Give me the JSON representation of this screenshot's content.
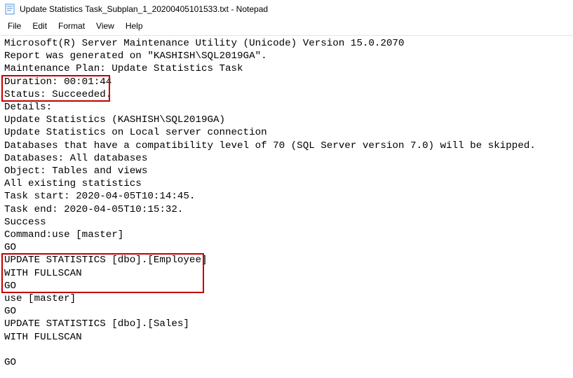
{
  "window": {
    "title": "Update Statistics Task_Subplan_1_20200405101533.txt - Notepad"
  },
  "menu": {
    "file": "File",
    "edit": "Edit",
    "format": "Format",
    "view": "View",
    "help": "Help"
  },
  "content": {
    "lines": [
      "Microsoft(R) Server Maintenance Utility (Unicode) Version 15.0.2070",
      "Report was generated on \"KASHISH\\SQL2019GA\".",
      "Maintenance Plan: Update Statistics Task",
      "Duration: 00:01:44",
      "Status: Succeeded.",
      "Details:",
      "Update Statistics (KASHISH\\SQL2019GA)",
      "Update Statistics on Local server connection",
      "Databases that have a compatibility level of 70 (SQL Server version 7.0) will be skipped.",
      "Databases: All databases",
      "Object: Tables and views",
      "All existing statistics",
      "Task start: 2020-04-05T10:14:45.",
      "Task end: 2020-04-05T10:15:32.",
      "Success",
      "Command:use [master]",
      "GO",
      "UPDATE STATISTICS [dbo].[Employee] ",
      "WITH FULLSCAN",
      "GO",
      "use [master]",
      "GO",
      "UPDATE STATISTICS [dbo].[Sales] ",
      "WITH FULLSCAN",
      "",
      "GO"
    ]
  }
}
